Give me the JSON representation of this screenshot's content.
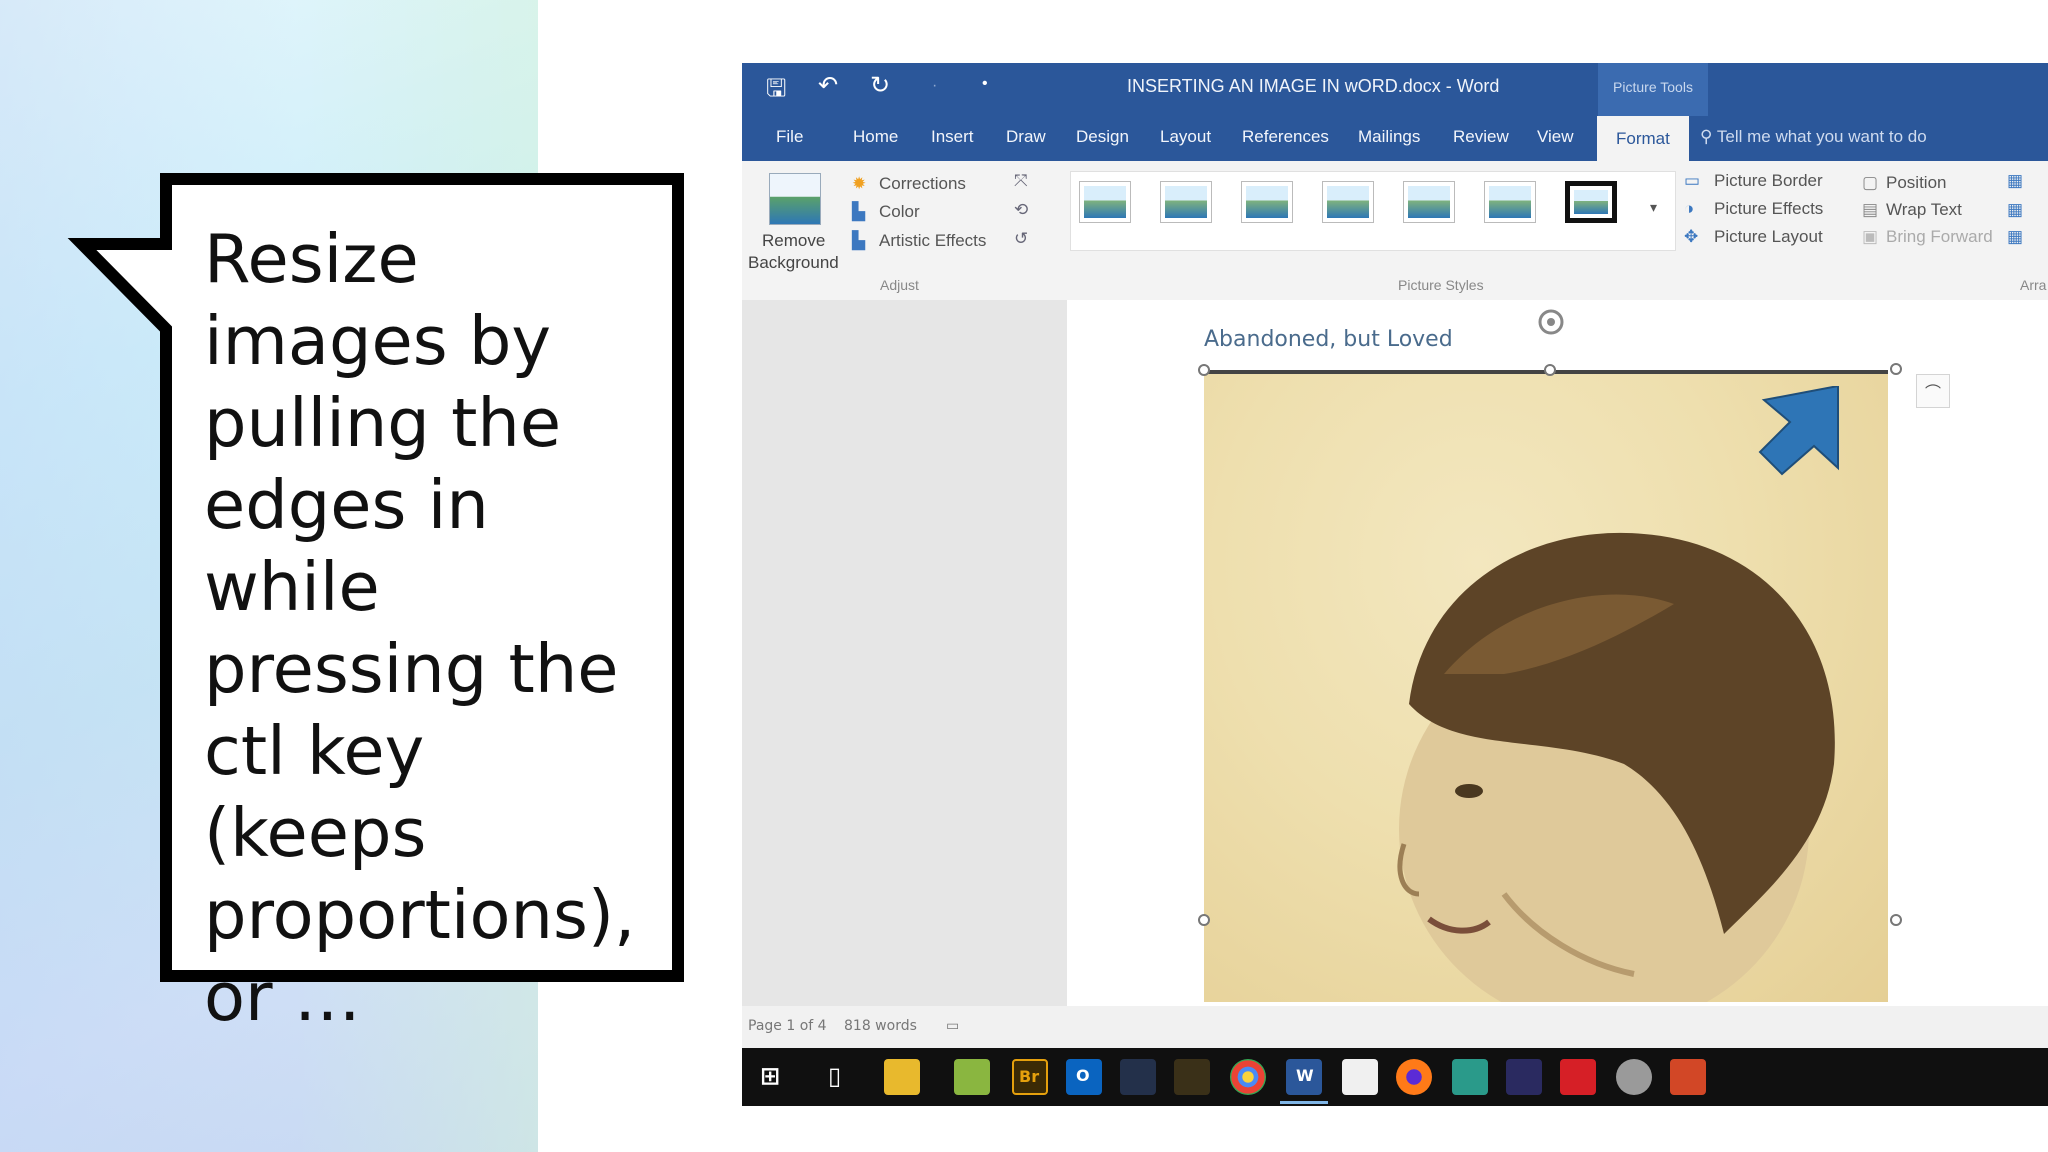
{
  "slide": {
    "callout_text": "Resize\nimages by\npulling the\nedges in\nwhile\npressing the\nctl key\n(keeps\nproportions),\nor …"
  },
  "word": {
    "title": "INSERTING AN IMAGE IN wORD.docx  -  Word",
    "picture_tools": "Picture Tools",
    "tabs": [
      "File",
      "Home",
      "Insert",
      "Draw",
      "Design",
      "Layout",
      "References",
      "Mailings",
      "Review",
      "View"
    ],
    "active_tab": "Format",
    "tell_me": "Tell me what you want to do",
    "ribbon": {
      "remove_background_1": "Remove",
      "remove_background_2": "Background",
      "corrections": "Corrections",
      "color": "Color",
      "artistic_effects": "Artistic Effects",
      "adjust_group": "Adjust",
      "picture_styles_group": "Picture Styles",
      "picture_border": "Picture Border",
      "picture_effects": "Picture Effects",
      "picture_layout": "Picture Layout",
      "position": "Position",
      "wrap_text": "Wrap Text",
      "bring_forward": "Bring Forward",
      "arrange_group": "Arra"
    },
    "document": {
      "caption": "Abandoned, but Loved"
    },
    "status": {
      "page": "Page 1 of 4",
      "words": "818 words"
    }
  },
  "taskbar": {
    "bridge_label": "Br",
    "outlook_label": "O",
    "word_label": "W"
  },
  "colors": {
    "word_blue": "#2b579a",
    "arrow_blue": "#2e75b6",
    "callout_border": "#000000"
  }
}
